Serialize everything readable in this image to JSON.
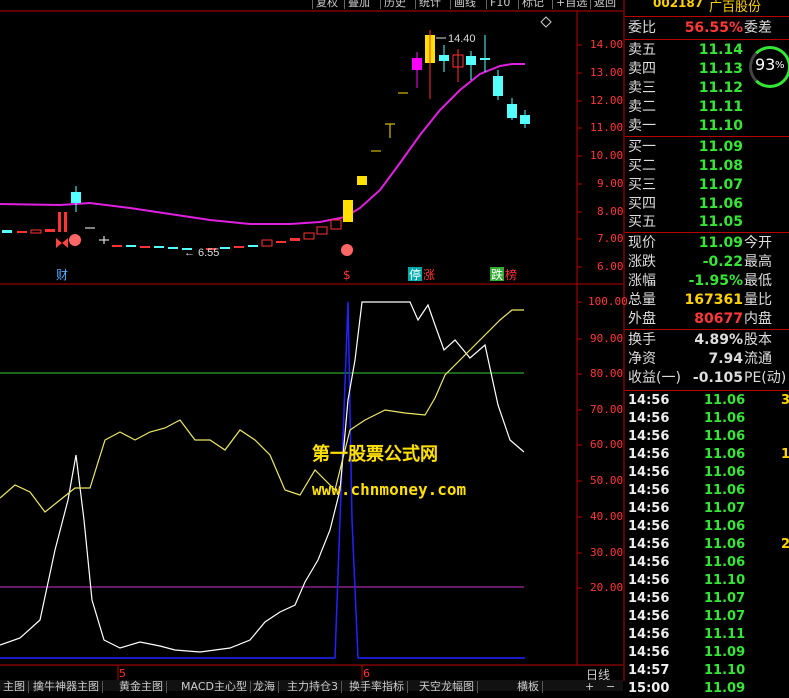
{
  "toolbar": {
    "buttons": [
      "复权",
      "叠加",
      "历史",
      "统计",
      "画线",
      "F10",
      "标记",
      "+自选",
      "返回"
    ]
  },
  "stock": {
    "code": "002187",
    "name": "广百股份"
  },
  "main_chart": {
    "y_ticks": [
      "14.00",
      "13.00",
      "12.00",
      "11.00",
      "10.00",
      "9.00",
      "8.00",
      "7.00",
      "6.00"
    ],
    "high_label": "14.40",
    "low_label": "6.55",
    "marks": {
      "cai": "财",
      "dollar": "$",
      "ting": "停",
      "zhang": "涨",
      "die": "跌",
      "ting2": "榜"
    }
  },
  "sub_chart": {
    "y_ticks": [
      "100.00",
      "90.00",
      "80.00",
      "70.00",
      "60.00",
      "50.00",
      "40.00",
      "30.00",
      "20.00"
    ],
    "watermark1": "第一股票公式网",
    "watermark2": "www.chnmoney.com"
  },
  "axis": {
    "label5": "5",
    "label6": "6",
    "period": "日线"
  },
  "quote": {
    "weibi_label": "委比",
    "weibi_val": "56.55%",
    "weicha_label": "委差",
    "sell": [
      {
        "label": "卖五",
        "price": "11.14"
      },
      {
        "label": "卖四",
        "price": "11.13"
      },
      {
        "label": "卖三",
        "price": "11.12"
      },
      {
        "label": "卖二",
        "price": "11.11"
      },
      {
        "label": "卖一",
        "price": "11.10"
      }
    ],
    "buy": [
      {
        "label": "买一",
        "price": "11.09"
      },
      {
        "label": "买二",
        "price": "11.08"
      },
      {
        "label": "买三",
        "price": "11.07"
      },
      {
        "label": "买四",
        "price": "11.06"
      },
      {
        "label": "买五",
        "price": "11.05"
      }
    ],
    "ring_value": "93",
    "ring_unit": "%",
    "stats": [
      {
        "label": "现价",
        "val": "11.09",
        "color": "#36e636",
        "lab2": "今开"
      },
      {
        "label": "涨跌",
        "val": "-0.22",
        "color": "#36e636",
        "lab2": "最高"
      },
      {
        "label": "涨幅",
        "val": "-1.95%",
        "color": "#36e636",
        "lab2": "最低"
      },
      {
        "label": "总量",
        "val": "167361",
        "color": "#ffd200",
        "lab2": "量比"
      },
      {
        "label": "外盘",
        "val": "80677",
        "color": "#ff3838",
        "lab2": "内盘"
      },
      {
        "label": "换手",
        "val": "4.89%",
        "color": "#dddddd",
        "lab2": "股本"
      },
      {
        "label": "净资",
        "val": "7.94",
        "color": "#dddddd",
        "lab2": "流通"
      },
      {
        "label": "收益(一)",
        "val": "-0.105",
        "color": "#dddddd",
        "lab2": "PE(动)"
      }
    ]
  },
  "ticks": [
    {
      "t": "14:56",
      "p": "11.06",
      "v": "3"
    },
    {
      "t": "14:56",
      "p": "11.06",
      "v": ""
    },
    {
      "t": "14:56",
      "p": "11.06",
      "v": ""
    },
    {
      "t": "14:56",
      "p": "11.06",
      "v": "1"
    },
    {
      "t": "14:56",
      "p": "11.06",
      "v": ""
    },
    {
      "t": "14:56",
      "p": "11.06",
      "v": ""
    },
    {
      "t": "14:56",
      "p": "11.07",
      "v": ""
    },
    {
      "t": "14:56",
      "p": "11.06",
      "v": ""
    },
    {
      "t": "14:56",
      "p": "11.06",
      "v": "2"
    },
    {
      "t": "14:56",
      "p": "11.06",
      "v": ""
    },
    {
      "t": "14:56",
      "p": "11.10",
      "v": ""
    },
    {
      "t": "14:56",
      "p": "11.07",
      "v": ""
    },
    {
      "t": "14:56",
      "p": "11.07",
      "v": ""
    },
    {
      "t": "14:56",
      "p": "11.11",
      "v": ""
    },
    {
      "t": "14:56",
      "p": "11.09",
      "v": ""
    },
    {
      "t": "14:57",
      "p": "11.10",
      "v": ""
    },
    {
      "t": "15:00",
      "p": "11.09",
      "v": ""
    }
  ],
  "bottom_tabs": [
    "主图",
    "擒牛神器主图",
    "黄金主图",
    "MACD主心型",
    "龙海",
    "主力持仓3",
    "换手率指标",
    "天空龙幅图",
    "横板"
  ]
}
